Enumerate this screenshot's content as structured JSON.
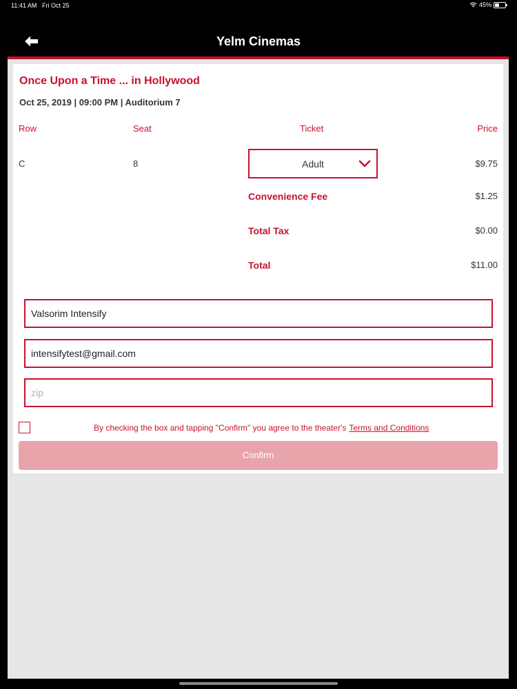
{
  "status_bar": {
    "time": "11:41 AM",
    "date": "Fri Oct 25",
    "battery": "45%",
    "battery_level": 0.45
  },
  "nav": {
    "title": "Yelm Cinemas",
    "back_icon": "arrow-left-icon"
  },
  "movie": {
    "title": "Once Upon a Time ... in Hollywood",
    "showtime": "Oct 25, 2019 | 09:00 PM | Auditorium 7"
  },
  "table": {
    "headers": {
      "row": "Row",
      "seat": "Seat",
      "ticket": "Ticket",
      "price": "Price"
    },
    "row": "C",
    "seat": "8",
    "ticket_type": "Adult",
    "price": "$9.75"
  },
  "fees": {
    "convenience_label": "Convenience Fee",
    "convenience_value": "$1.25",
    "tax_label": "Total Tax",
    "tax_value": "$0.00",
    "total_label": "Total",
    "total_value": "$11.00"
  },
  "form": {
    "name_value": "Valsorim Intensify",
    "email_value": "intensifytest@gmail.com",
    "zip_placeholder": "zip",
    "agree_text": "By checking the box and tapping \"Confirm\" you agree to the theater's",
    "terms_link": "Terms and Conditions",
    "confirm_label": "Confirm"
  },
  "colors": {
    "accent": "#c8102e",
    "confirm_disabled": "#e8a4ab",
    "background": "#e7e6e7"
  }
}
